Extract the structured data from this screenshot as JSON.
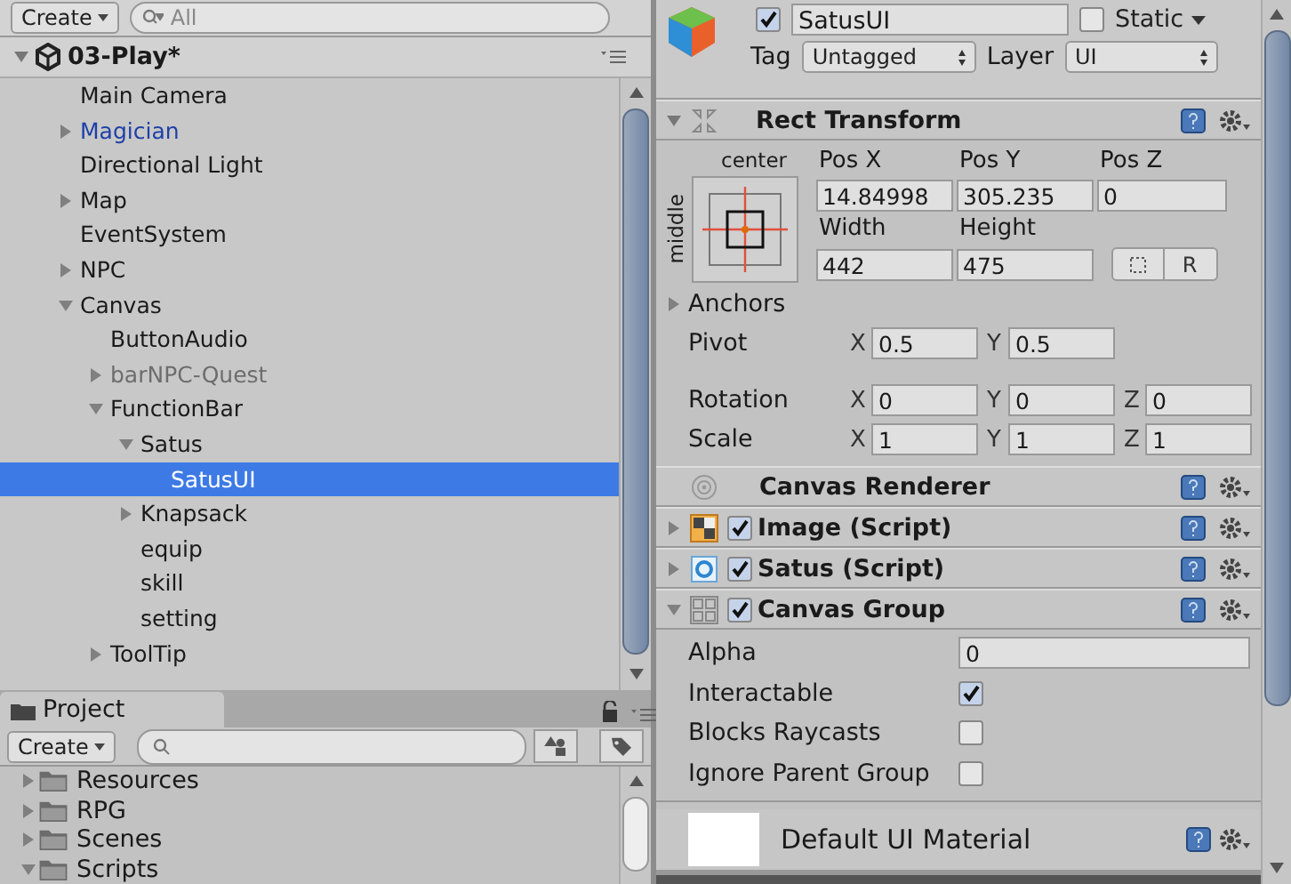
{
  "hierarchy": {
    "create_button": "Create",
    "search_placeholder": "All",
    "scene": {
      "name": "03-Play*",
      "expanded": true
    },
    "items": [
      {
        "name": "Main Camera",
        "color": "#1a1a1a",
        "selected": false
      },
      {
        "name": "Magician",
        "color": "#1f3fa8",
        "expanded": false,
        "selected": false
      },
      {
        "name": "Directional Light",
        "color": "#1a1a1a",
        "selected": false
      },
      {
        "name": "Map",
        "color": "#1a1a1a",
        "expanded": false,
        "selected": false
      },
      {
        "name": "EventSystem",
        "color": "#1a1a1a",
        "selected": false
      },
      {
        "name": "NPC",
        "color": "#1a1a1a",
        "expanded": false,
        "selected": false
      },
      {
        "name": "Canvas",
        "color": "#1a1a1a",
        "expanded": true,
        "selected": false,
        "children": [
          {
            "name": "ButtonAudio",
            "color": "#1a1a1a",
            "selected": false
          },
          {
            "name": "barNPC-Quest",
            "color": "#6d6d6d",
            "expanded": false,
            "selected": false
          },
          {
            "name": "FunctionBar",
            "color": "#1a1a1a",
            "expanded": true,
            "selected": false,
            "children": [
              {
                "name": "Satus",
                "color": "#1a1a1a",
                "expanded": true,
                "selected": false,
                "children": [
                  {
                    "name": "SatusUI",
                    "color": "#ffffff",
                    "selected": true
                  }
                ]
              },
              {
                "name": "Knapsack",
                "color": "#1a1a1a",
                "expanded": false,
                "selected": false
              },
              {
                "name": "equip",
                "color": "#1a1a1a",
                "selected": false
              },
              {
                "name": "skill",
                "color": "#1a1a1a",
                "selected": false
              },
              {
                "name": "setting",
                "color": "#1a1a1a",
                "selected": false
              }
            ]
          },
          {
            "name": "ToolTip",
            "color": "#1a1a1a",
            "expanded": false,
            "selected": false
          }
        ]
      }
    ]
  },
  "project": {
    "tab": "Project",
    "create_button": "Create",
    "folders": [
      {
        "name": "Resources",
        "expanded": false
      },
      {
        "name": "RPG",
        "expanded": false
      },
      {
        "name": "Scenes",
        "expanded": false
      },
      {
        "name": "Scripts",
        "expanded": true
      }
    ]
  },
  "inspector": {
    "active": true,
    "name": "SatusUI",
    "static": false,
    "static_label": "Static",
    "tag_label": "Tag",
    "tag": "Untagged",
    "layer_label": "Layer",
    "layer": "UI",
    "rect_transform": {
      "title": "Rect Transform",
      "expanded": true,
      "anchor_h": "center",
      "anchor_v": "middle",
      "pos": [
        {
          "label": "Pos X",
          "value": "14.84998"
        },
        {
          "label": "Pos Y",
          "value": "305.235"
        },
        {
          "label": "Pos Z",
          "value": "0"
        }
      ],
      "size": [
        {
          "label": "Width",
          "value": "442"
        },
        {
          "label": "Height",
          "value": "475"
        }
      ],
      "raw_button": "R",
      "anchors_label": "Anchors",
      "pivot_label": "Pivot",
      "pivot": [
        {
          "axis": "X",
          "value": "0.5"
        },
        {
          "axis": "Y",
          "value": "0.5"
        }
      ],
      "rotation_label": "Rotation",
      "rotation": [
        {
          "axis": "X",
          "value": "0"
        },
        {
          "axis": "Y",
          "value": "0"
        },
        {
          "axis": "Z",
          "value": "0"
        }
      ],
      "scale_label": "Scale",
      "scale": [
        {
          "axis": "X",
          "value": "1"
        },
        {
          "axis": "Y",
          "value": "1"
        },
        {
          "axis": "Z",
          "value": "1"
        }
      ]
    },
    "components": [
      {
        "kind": "renderer",
        "title": "Canvas Renderer"
      },
      {
        "kind": "image",
        "title": "Image (Script)",
        "enabled": true,
        "expanded": false
      },
      {
        "kind": "script",
        "title": "Satus (Script)",
        "enabled": true,
        "expanded": false
      },
      {
        "kind": "group",
        "title": "Canvas Group",
        "enabled": true,
        "expanded": true
      }
    ],
    "canvas_group": {
      "alpha_label": "Alpha",
      "alpha": "0",
      "toggles": [
        {
          "label": "Interactable",
          "checked": true
        },
        {
          "label": "Blocks Raycasts",
          "checked": false
        },
        {
          "label": "Ignore Parent Group",
          "checked": false
        }
      ]
    },
    "material": "Default UI Material"
  }
}
